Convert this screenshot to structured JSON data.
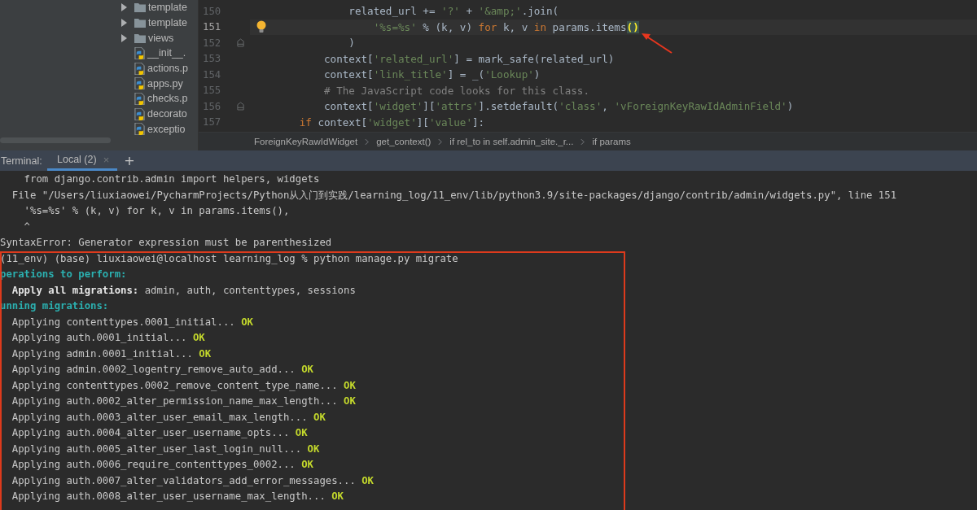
{
  "project_tree": {
    "items": [
      {
        "kind": "folder",
        "label": "template",
        "expanded": false
      },
      {
        "kind": "folder",
        "label": "template",
        "expanded": false
      },
      {
        "kind": "folder",
        "label": "views",
        "expanded": false
      },
      {
        "kind": "file",
        "label": "__init__."
      },
      {
        "kind": "file",
        "label": "actions.p"
      },
      {
        "kind": "file",
        "label": "apps.py"
      },
      {
        "kind": "file",
        "label": "checks.p"
      },
      {
        "kind": "file",
        "label": "decorato"
      },
      {
        "kind": "file",
        "label": "exceptio"
      }
    ]
  },
  "editor": {
    "lines": [
      {
        "number": "150",
        "current": false,
        "bulb": false,
        "fold": false,
        "tokens": [
          {
            "kind": "plain",
            "text": "                related_url += "
          },
          {
            "kind": "string",
            "text": "'?'"
          },
          {
            "kind": "plain",
            "text": " + "
          },
          {
            "kind": "string",
            "text": "'&amp;'"
          },
          {
            "kind": "plain",
            "text": ".join("
          }
        ]
      },
      {
        "number": "151",
        "current": true,
        "bulb": true,
        "fold": false,
        "tokens": [
          {
            "kind": "string",
            "text": "                    '%s=%s'"
          },
          {
            "kind": "plain",
            "text": " % (k, v) "
          },
          {
            "kind": "keyword",
            "text": "for"
          },
          {
            "kind": "plain",
            "text": " k, v "
          },
          {
            "kind": "keyword",
            "text": "in"
          },
          {
            "kind": "plain",
            "text": " params.items"
          },
          {
            "kind": "match",
            "text": "()"
          }
        ]
      },
      {
        "number": "152",
        "current": false,
        "bulb": false,
        "fold": true,
        "tokens": [
          {
            "kind": "plain",
            "text": "                )"
          }
        ]
      },
      {
        "number": "153",
        "current": false,
        "bulb": false,
        "fold": false,
        "tokens": [
          {
            "kind": "plain",
            "text": "            context["
          },
          {
            "kind": "string",
            "text": "'related_url'"
          },
          {
            "kind": "plain",
            "text": "] = mark_safe(related_url)"
          }
        ]
      },
      {
        "number": "154",
        "current": false,
        "bulb": false,
        "fold": false,
        "tokens": [
          {
            "kind": "plain",
            "text": "            context["
          },
          {
            "kind": "string",
            "text": "'link_title'"
          },
          {
            "kind": "plain",
            "text": "] = _("
          },
          {
            "kind": "string",
            "text": "'Lookup'"
          },
          {
            "kind": "plain",
            "text": ")"
          }
        ]
      },
      {
        "number": "155",
        "current": false,
        "bulb": false,
        "fold": false,
        "tokens": [
          {
            "kind": "comment",
            "text": "            # The JavaScript code looks for this class."
          }
        ]
      },
      {
        "number": "156",
        "current": false,
        "bulb": false,
        "fold": true,
        "tokens": [
          {
            "kind": "plain",
            "text": "            context["
          },
          {
            "kind": "string",
            "text": "'widget'"
          },
          {
            "kind": "plain",
            "text": "]["
          },
          {
            "kind": "string",
            "text": "'attrs'"
          },
          {
            "kind": "plain",
            "text": "].setdefault("
          },
          {
            "kind": "string",
            "text": "'class'"
          },
          {
            "kind": "plain",
            "text": ", "
          },
          {
            "kind": "string",
            "text": "'vForeignKeyRawIdAdminField'"
          },
          {
            "kind": "plain",
            "text": ")"
          }
        ]
      },
      {
        "number": "157",
        "current": false,
        "bulb": false,
        "fold": false,
        "tokens": [
          {
            "kind": "keyword",
            "text": "        if"
          },
          {
            "kind": "plain",
            "text": " context["
          },
          {
            "kind": "string",
            "text": "'widget'"
          },
          {
            "kind": "plain",
            "text": "]["
          },
          {
            "kind": "string",
            "text": "'value'"
          },
          {
            "kind": "plain",
            "text": "]:"
          }
        ]
      }
    ],
    "breadcrumbs": [
      "ForeignKeyRawIdWidget",
      "get_context()",
      "if rel_to in self.admin_site._r...",
      "if params"
    ]
  },
  "terminal": {
    "label": "Terminal:",
    "tabs": [
      {
        "label": "Local (2)",
        "selected": true,
        "close": "×"
      }
    ],
    "new_tab": "+",
    "lines": [
      [
        {
          "kind": "plain",
          "text": "    from django.contrib.admin import helpers, widgets"
        }
      ],
      [
        {
          "kind": "plain",
          "text": "  File \"/Users/liuxiaowei/PycharmProjects/Python从入门到实践/learning_log/11_env/lib/python3.9/site-packages/django/contrib/admin/widgets.py\", line 151"
        }
      ],
      [
        {
          "kind": "plain",
          "text": "    '%s=%s' % (k, v) for k, v in params.items(),"
        }
      ],
      [
        {
          "kind": "plain",
          "text": "    ^"
        }
      ],
      [
        {
          "kind": "plain",
          "text": "SyntaxError: Generator expression must be parenthesized"
        }
      ],
      [
        {
          "kind": "plain",
          "text": "(11_env) (base) liuxiaowei@localhost learning_log % python manage.py migrate"
        }
      ],
      [
        {
          "kind": "heading",
          "text": "perations to perform:"
        }
      ],
      [
        {
          "kind": "bold",
          "text": "  Apply all migrations:"
        },
        {
          "kind": "plain",
          "text": " admin, auth, contenttypes, sessions"
        }
      ],
      [
        {
          "kind": "heading",
          "text": "unning migrations:"
        }
      ],
      [
        {
          "kind": "plain",
          "text": "  Applying contenttypes.0001_initial... "
        },
        {
          "kind": "ok",
          "text": "OK"
        }
      ],
      [
        {
          "kind": "plain",
          "text": "  Applying auth.0001_initial... "
        },
        {
          "kind": "ok",
          "text": "OK"
        }
      ],
      [
        {
          "kind": "plain",
          "text": "  Applying admin.0001_initial... "
        },
        {
          "kind": "ok",
          "text": "OK"
        }
      ],
      [
        {
          "kind": "plain",
          "text": "  Applying admin.0002_logentry_remove_auto_add... "
        },
        {
          "kind": "ok",
          "text": "OK"
        }
      ],
      [
        {
          "kind": "plain",
          "text": "  Applying contenttypes.0002_remove_content_type_name... "
        },
        {
          "kind": "ok",
          "text": "OK"
        }
      ],
      [
        {
          "kind": "plain",
          "text": "  Applying auth.0002_alter_permission_name_max_length... "
        },
        {
          "kind": "ok",
          "text": "OK"
        }
      ],
      [
        {
          "kind": "plain",
          "text": "  Applying auth.0003_alter_user_email_max_length... "
        },
        {
          "kind": "ok",
          "text": "OK"
        }
      ],
      [
        {
          "kind": "plain",
          "text": "  Applying auth.0004_alter_user_username_opts... "
        },
        {
          "kind": "ok",
          "text": "OK"
        }
      ],
      [
        {
          "kind": "plain",
          "text": "  Applying auth.0005_alter_user_last_login_null... "
        },
        {
          "kind": "ok",
          "text": "OK"
        }
      ],
      [
        {
          "kind": "plain",
          "text": "  Applying auth.0006_require_contenttypes_0002... "
        },
        {
          "kind": "ok",
          "text": "OK"
        }
      ],
      [
        {
          "kind": "plain",
          "text": "  Applying auth.0007_alter_validators_add_error_messages... "
        },
        {
          "kind": "ok",
          "text": "OK"
        }
      ],
      [
        {
          "kind": "plain",
          "text": "  Applying auth.0008_alter_user_username_max_length... "
        },
        {
          "kind": "ok",
          "text": "OK"
        }
      ]
    ]
  }
}
